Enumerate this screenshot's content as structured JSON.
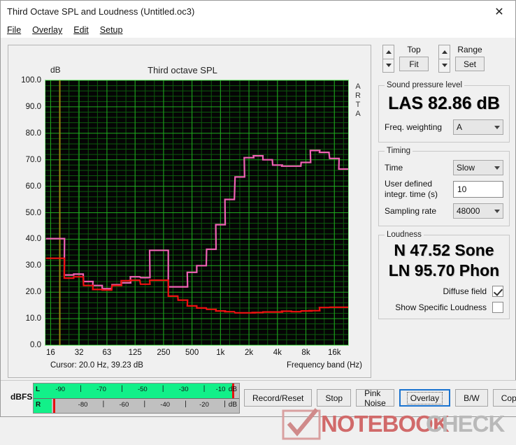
{
  "window": {
    "title": "Third Octave SPL and Loudness (Untitled.oc3)",
    "close_icon": "close-icon"
  },
  "menu": [
    {
      "label": "File",
      "accel": "F"
    },
    {
      "label": "Overlay",
      "accel": "O"
    },
    {
      "label": "Edit",
      "accel": "E"
    },
    {
      "label": "Setup",
      "accel": "S"
    }
  ],
  "chart_panel": {
    "title": "Third octave SPL",
    "y_unit": "dB",
    "watermark_label": "ARTA",
    "cursor_text": "Cursor:   20.0 Hz, 39.23 dB",
    "x_axis_label": "Frequency band (Hz)"
  },
  "chart_data": {
    "type": "line",
    "title": "Third octave SPL",
    "xlabel": "Frequency band (Hz)",
    "ylabel": "dB",
    "ylim": [
      0.0,
      100.0
    ],
    "ytick_labels": [
      "0.0",
      "10.0",
      "20.0",
      "30.0",
      "40.0",
      "50.0",
      "60.0",
      "70.0",
      "80.0",
      "90.0",
      "100.0"
    ],
    "yticks": [
      0,
      10,
      20,
      30,
      40,
      50,
      60,
      70,
      80,
      90,
      100
    ],
    "xtick_labels": [
      "16",
      "32",
      "63",
      "125",
      "250",
      "500",
      "1k",
      "2k",
      "4k",
      "8k",
      "16k"
    ],
    "xticks": [
      16,
      32,
      63,
      125,
      250,
      500,
      1000,
      2000,
      4000,
      8000,
      16000
    ],
    "grid": true,
    "legend": "none",
    "x_bands": [
      16,
      20,
      25,
      31.5,
      40,
      50,
      63,
      80,
      100,
      125,
      160,
      200,
      250,
      315,
      400,
      500,
      630,
      800,
      1000,
      1250,
      1600,
      2000,
      2500,
      3150,
      4000,
      5000,
      6300,
      8000,
      10000,
      12500,
      16000,
      20000
    ],
    "series": [
      {
        "name": "Overlay (third octave SPL)",
        "color": "#F062B4",
        "step": true,
        "values": [
          40.2,
          40.2,
          26.5,
          26.8,
          24.0,
          22.5,
          21.3,
          22.8,
          23.5,
          25.8,
          25.5,
          35.8,
          35.8,
          22.0,
          22.0,
          27.5,
          30.0,
          36.2,
          45.5,
          55.0,
          63.5,
          70.8,
          71.5,
          70.0,
          68.0,
          67.6,
          67.6,
          69.0,
          73.5,
          72.8,
          70.5,
          66.5
        ]
      },
      {
        "name": "Current (third octave SPL)",
        "color": "#EE1010",
        "step": true,
        "values": [
          32.8,
          32.8,
          25.3,
          25.8,
          22.5,
          21.0,
          20.8,
          22.5,
          24.3,
          24.5,
          23.0,
          24.5,
          24.5,
          18.5,
          17.0,
          14.8,
          14.0,
          13.5,
          12.9,
          12.6,
          12.2,
          12.2,
          12.3,
          12.5,
          12.5,
          12.8,
          12.6,
          12.9,
          13.0,
          14.2,
          14.3,
          14.3
        ]
      }
    ],
    "cursor_line": {
      "x_hz": 20.0,
      "value_db": 39.23,
      "color": "#9a8410"
    }
  },
  "top_controls": {
    "top": {
      "label": "Top",
      "button": "Fit",
      "up_icon": "arrow-up-icon",
      "down_icon": "arrow-down-icon"
    },
    "range": {
      "label": "Range",
      "button": "Set",
      "up_icon": "arrow-up-icon",
      "down_icon": "arrow-down-icon"
    }
  },
  "spl": {
    "group": "Sound pressure level",
    "value": "LAS 82.86 dB",
    "weighting_label": "Freq. weighting",
    "weighting_value": "A"
  },
  "timing": {
    "group": "Timing",
    "time_label": "Time",
    "time_value": "Slow",
    "integr_label_line1": "User defined",
    "integr_label_line2": "integr. time (s)",
    "integr_value": "10",
    "sampling_label": "Sampling rate",
    "sampling_value": "48000"
  },
  "loudness": {
    "group": "Loudness",
    "sone": "N 47.52 Sone",
    "phon": "LN 95.70 Phon",
    "diffuse_label": "Diffuse field",
    "diffuse_checked": true,
    "specific_label": "Show Specific Loudness",
    "specific_checked": false
  },
  "meters": {
    "unit_label": "dBFS",
    "left": {
      "channel": "L",
      "db_label": "dB",
      "ticks": [
        "-90",
        "-70",
        "-50",
        "-30",
        "-10"
      ],
      "fill_pct": 97,
      "marker_pct": 96.5
    },
    "right": {
      "channel": "R",
      "db_label": "dB",
      "ticks": [
        "-80",
        "-60",
        "-40",
        "-20"
      ],
      "fill_pct": 9,
      "marker_pct": 9.5
    }
  },
  "buttons": [
    {
      "label": "Record/Reset",
      "focused": false
    },
    {
      "label": "Stop",
      "focused": false
    },
    {
      "label": "Pink Noise",
      "focused": false
    },
    {
      "label": "Overlay",
      "focused": true
    },
    {
      "label": "B/W",
      "focused": false
    },
    {
      "label": "Copy",
      "focused": false
    }
  ],
  "watermark": {
    "part1": "NOTEBOOK",
    "part2": "CHECK",
    "part1_color": "#d16a6a",
    "part2_color": "#b9b9b9"
  }
}
